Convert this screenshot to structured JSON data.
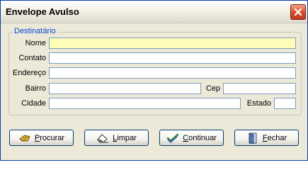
{
  "window": {
    "title": "Envelope Avulso"
  },
  "group": {
    "legend": "Destinatário"
  },
  "fields": {
    "nome": {
      "label": "Nome",
      "value": ""
    },
    "contato": {
      "label": "Contato",
      "value": ""
    },
    "endereco": {
      "label": "Endereço",
      "value": ""
    },
    "bairro": {
      "label": "Bairro",
      "value": ""
    },
    "cep": {
      "label": "Cep",
      "value": ""
    },
    "cidade": {
      "label": "Cidade",
      "value": ""
    },
    "estado": {
      "label": "Estado",
      "value": ""
    }
  },
  "buttons": {
    "procurar": {
      "first": "P",
      "rest": "rocurar"
    },
    "limpar": {
      "first": "L",
      "rest": "impar"
    },
    "continuar": {
      "first": "C",
      "rest": "ontinuar"
    },
    "fechar": {
      "first": "F",
      "rest": "echar"
    }
  },
  "colors": {
    "focus_field": "#fdfdb8",
    "legend_text": "#0046d5",
    "window_bg": "#ece9d8",
    "close_button": "#d8502e"
  },
  "icons": {
    "close": "close-icon",
    "procurar": "search-binoculars-icon",
    "limpar": "eraser-icon",
    "continuar": "checkmark-icon",
    "fechar": "exit-door-icon"
  }
}
